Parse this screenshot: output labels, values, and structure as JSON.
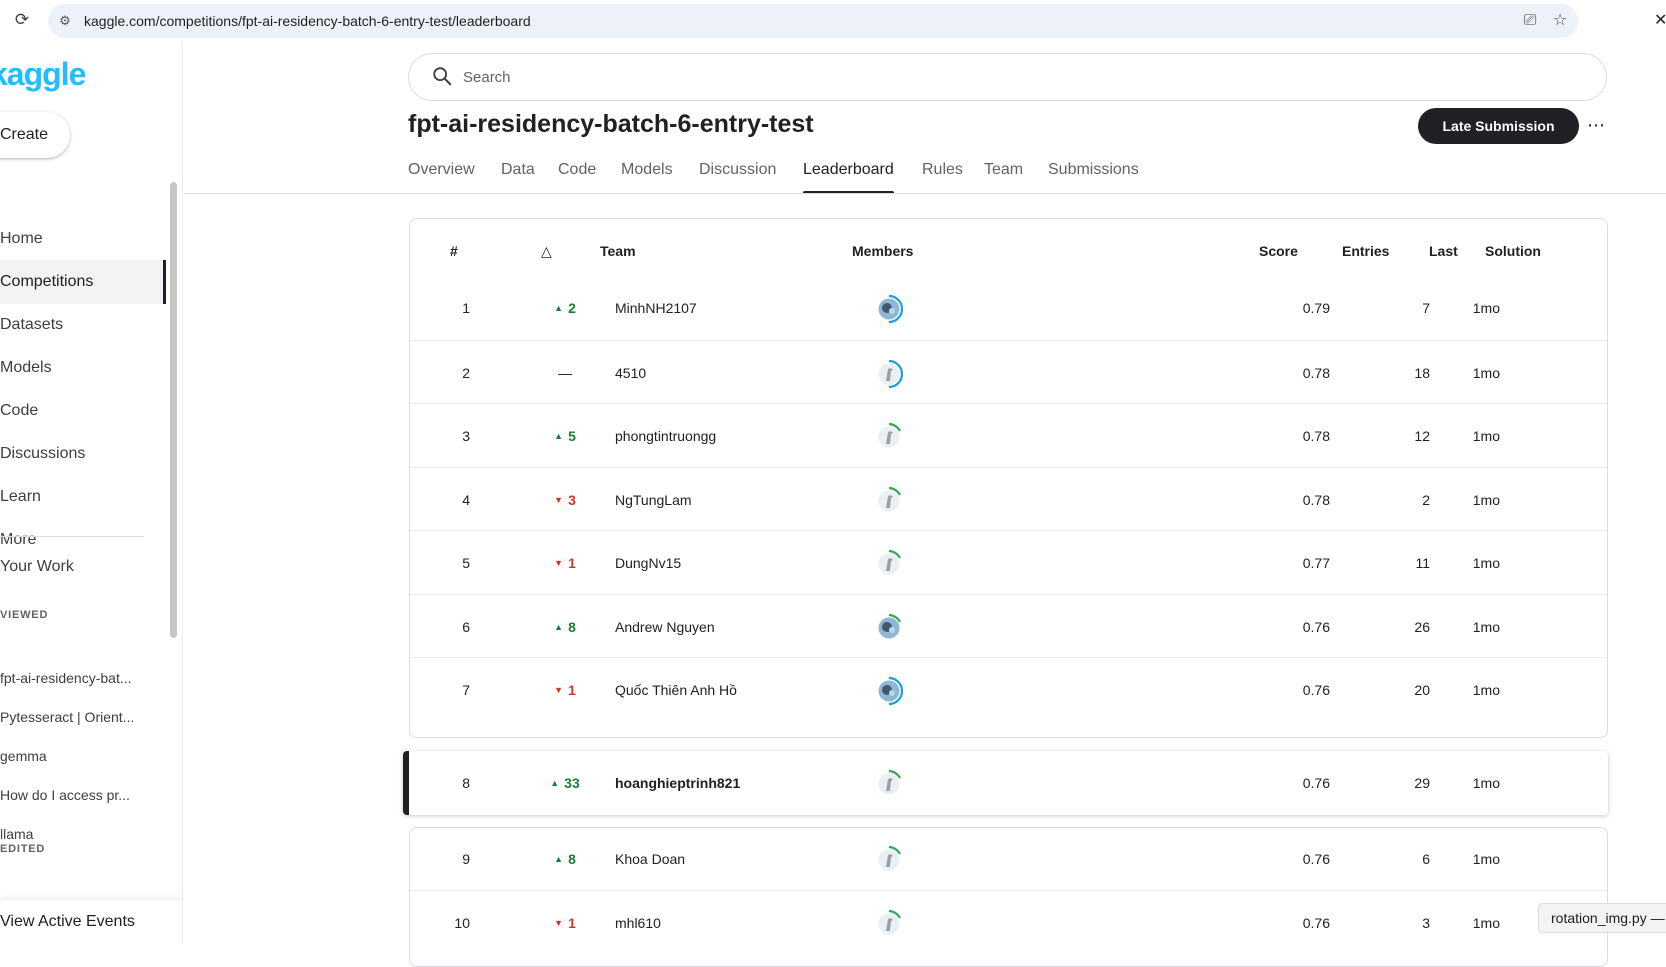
{
  "browser": {
    "url": "kaggle.com/competitions/fpt-ai-residency-batch-6-entry-test/leaderboard"
  },
  "sidebar": {
    "logo": "kaggle",
    "create_label": "Create",
    "nav": [
      {
        "label": "Home",
        "name": "home"
      },
      {
        "label": "Competitions",
        "name": "competitions",
        "active": true
      },
      {
        "label": "Datasets",
        "name": "datasets"
      },
      {
        "label": "Models",
        "name": "models"
      },
      {
        "label": "Code",
        "name": "code"
      },
      {
        "label": "Discussions",
        "name": "discussions"
      },
      {
        "label": "Learn",
        "name": "learn"
      },
      {
        "label": "More",
        "name": "more"
      }
    ],
    "your_work": "Your Work",
    "viewed_label": "VIEWED",
    "viewed": [
      "fpt-ai-residency-bat...",
      "Pytesseract | Orient...",
      "gemma",
      "How do I access pr...",
      "llama"
    ],
    "edited_label": "EDITED",
    "footer": "View Active Events"
  },
  "search": {
    "placeholder": "Search"
  },
  "competition": {
    "title": "fpt-ai-residency-batch-6-entry-test",
    "late_submission": "Late Submission"
  },
  "tabs": [
    "Overview",
    "Data",
    "Code",
    "Models",
    "Discussion",
    "Leaderboard",
    "Rules",
    "Team",
    "Submissions"
  ],
  "active_tab": "Leaderboard",
  "leaderboard": {
    "headers": {
      "rank": "#",
      "delta": "△",
      "team": "Team",
      "members": "Members",
      "score": "Score",
      "entries": "Entries",
      "last": "Last",
      "solution": "Solution"
    },
    "rows": [
      {
        "rank": "1",
        "delta": "2",
        "dir": "up",
        "team": "MinhNH2107",
        "score": "0.79",
        "entries": "7",
        "last": "1mo",
        "avatar": "photo-blue"
      },
      {
        "rank": "2",
        "delta": "—",
        "dir": "same",
        "team": "4510",
        "score": "0.78",
        "entries": "18",
        "last": "1mo",
        "avatar": "default-blue"
      },
      {
        "rank": "3",
        "delta": "5",
        "dir": "up",
        "team": "phongtintruongg",
        "score": "0.78",
        "entries": "12",
        "last": "1mo",
        "avatar": "default-green"
      },
      {
        "rank": "4",
        "delta": "3",
        "dir": "down",
        "team": "NgTungLam",
        "score": "0.78",
        "entries": "2",
        "last": "1mo",
        "avatar": "default-green"
      },
      {
        "rank": "5",
        "delta": "1",
        "dir": "down",
        "team": "DungNv15",
        "score": "0.77",
        "entries": "11",
        "last": "1mo",
        "avatar": "default-green"
      },
      {
        "rank": "6",
        "delta": "8",
        "dir": "up",
        "team": "Andrew Nguyen",
        "score": "0.76",
        "entries": "26",
        "last": "1mo",
        "avatar": "photo-green"
      },
      {
        "rank": "7",
        "delta": "1",
        "dir": "down",
        "team": "Quốc Thiên Anh Hồ",
        "score": "0.76",
        "entries": "20",
        "last": "1mo",
        "avatar": "photo-blue"
      },
      {
        "rank": "8",
        "delta": "33",
        "dir": "up",
        "team": "hoanghieptrinh821",
        "score": "0.76",
        "entries": "29",
        "last": "1mo",
        "avatar": "default-green",
        "highlight": true
      },
      {
        "rank": "9",
        "delta": "8",
        "dir": "up",
        "team": "Khoa Doan",
        "score": "0.76",
        "entries": "6",
        "last": "1mo",
        "avatar": "default-green"
      },
      {
        "rank": "10",
        "delta": "1",
        "dir": "down",
        "team": "mhl610",
        "score": "0.76",
        "entries": "3",
        "last": "1mo",
        "avatar": "default-green"
      }
    ]
  },
  "toast": "rotation_img.py —",
  "colors": {
    "kaggle_blue": "#20beff",
    "up": "#188038",
    "down": "#d93025",
    "primary_dark": "#202124"
  }
}
